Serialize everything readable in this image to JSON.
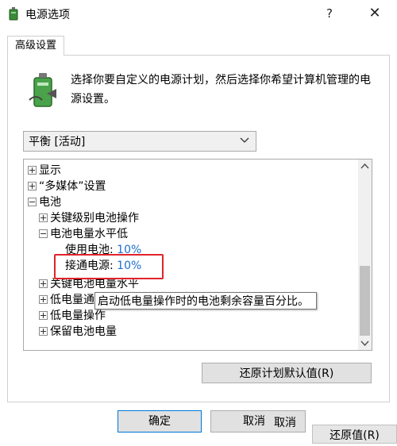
{
  "window": {
    "title": "电源选项",
    "help": "?",
    "close": "✕"
  },
  "tab": {
    "label": "高级设置"
  },
  "description": "选择你要自定义的电源计划，然后选择你希望计算机管理的电源设置。",
  "plan_select": {
    "value": "平衡 [活动]"
  },
  "tree": {
    "items": [
      {
        "label": "显示"
      },
      {
        "label": "“多媒体”设置"
      },
      {
        "label": "电池"
      },
      {
        "label": "关键级别电池操作"
      },
      {
        "label": "电池电量水平低"
      },
      {
        "label": "使用电池: ",
        "value": "10%"
      },
      {
        "label": "接通电源: ",
        "value": "10%"
      },
      {
        "label": "关键电池电量水平"
      },
      {
        "label": "低电量通"
      },
      {
        "label": "低电量操作"
      },
      {
        "label": "保留电池电量"
      }
    ]
  },
  "tooltip": "启动低电量操作时的电池剩余容量百分比。",
  "buttons": {
    "restore_plan": "还原计划默认值(R)",
    "ok": "确定",
    "cancel": "取消",
    "cancel_dup": "取消",
    "restore": "还原值(R)"
  },
  "colors": {
    "link": "#1c6fcc",
    "highlight_box": "#e0242a",
    "ok_border": "#0078d7"
  }
}
